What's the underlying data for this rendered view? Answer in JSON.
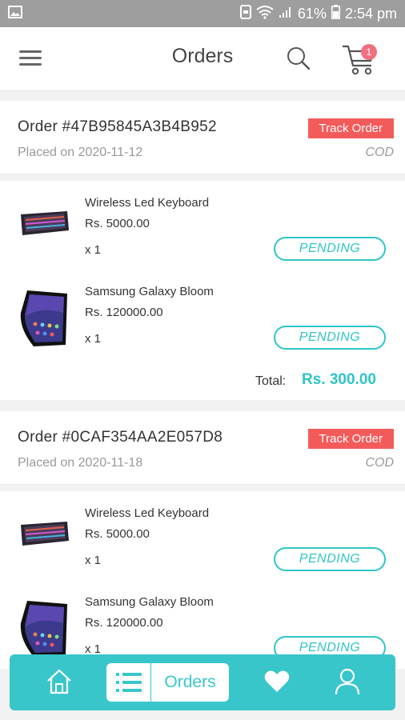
{
  "status_bar": {
    "battery": "61%",
    "time": "2:54 pm"
  },
  "header": {
    "title": "Orders",
    "cart_count": "1"
  },
  "orders": [
    {
      "order_id": "Order #47B95845A3B4B952",
      "placed": "Placed on 2020-11-12",
      "track_label": "Track Order",
      "payment": "COD",
      "items": [
        {
          "name": "Wireless Led Keyboard",
          "price": "Rs. 5000.00",
          "qty": "x  1",
          "status": "PENDING",
          "image": "keyboard"
        },
        {
          "name": "Samsung Galaxy Bloom",
          "price": "Rs. 120000.00",
          "qty": "x  1",
          "status": "PENDING",
          "image": "phone"
        }
      ],
      "total_label": "Total:",
      "total_value": "Rs. 300.00"
    },
    {
      "order_id": "Order #0CAF354AA2E057D8",
      "placed": "Placed on 2020-11-18",
      "track_label": "Track Order",
      "payment": "COD",
      "items": [
        {
          "name": "Wireless Led Keyboard",
          "price": "Rs. 5000.00",
          "qty": "x  1",
          "status": "PENDING",
          "image": "keyboard"
        },
        {
          "name": "Samsung Galaxy Bloom",
          "price": "Rs. 120000.00",
          "qty": "x  1",
          "status": "PENDING",
          "image": "phone"
        }
      ]
    }
  ],
  "bottom_nav": {
    "active_label": "Orders",
    "items": [
      "home-icon",
      "orders-list-icon",
      "heart-icon",
      "profile-icon"
    ]
  },
  "colors": {
    "accent": "#39c6cb",
    "track": "#f35b5b",
    "badge": "#f07080"
  }
}
